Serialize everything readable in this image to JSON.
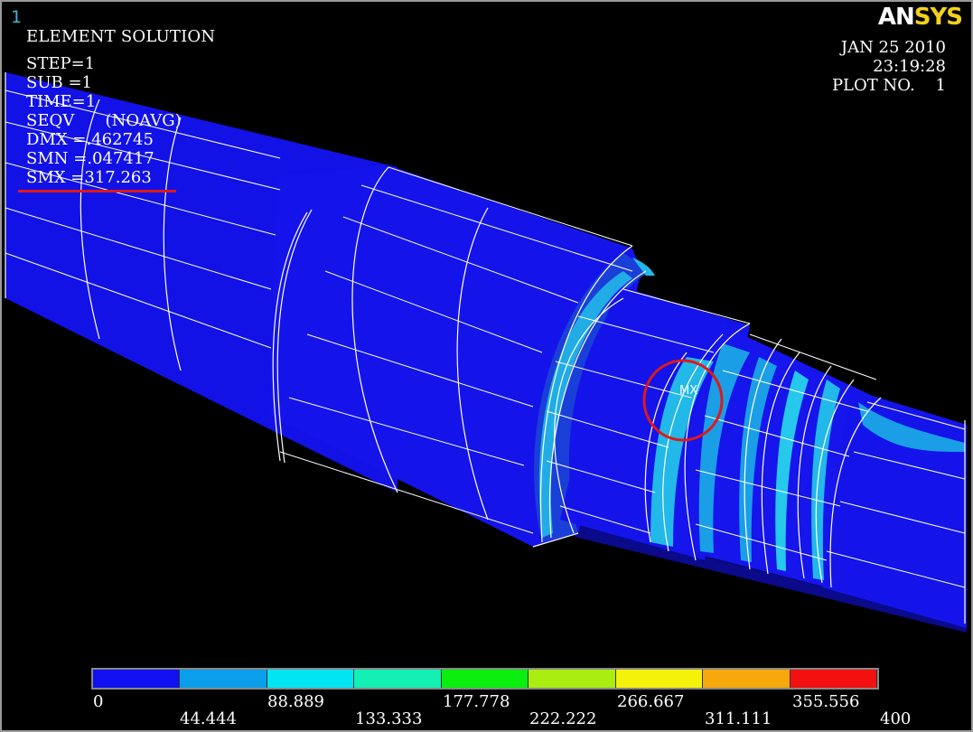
{
  "window_number": "1",
  "title": "ELEMENT SOLUTION",
  "info_lines": [
    "STEP=1",
    "SUB =1",
    "TIME=1",
    "SEQV      (NOAVG)",
    "DMX =.462745",
    "SMN =.047417",
    "SMX =317.263"
  ],
  "logo": {
    "part1": "AN",
    "part2": "SYS"
  },
  "date_block": [
    "JAN 25 2010",
    "23:19:28",
    "PLOT NO.    1"
  ],
  "mx_marker": "MX",
  "colors": {
    "background": "#000000",
    "shaft": "#1212e6",
    "mesh": "#ffffff",
    "annotation_red": "#e01818"
  },
  "legend": {
    "colors": [
      "#1010f0",
      "#0b9eea",
      "#00e5f2",
      "#12f0b4",
      "#0aef0e",
      "#a9ee10",
      "#f5f20a",
      "#f7a80a",
      "#f21010"
    ],
    "top_labels": [
      "0",
      "88.889",
      "177.778",
      "266.667",
      "355.556"
    ],
    "bottom_labels": [
      "44.444",
      "133.333",
      "222.222",
      "311.111",
      "400"
    ]
  }
}
